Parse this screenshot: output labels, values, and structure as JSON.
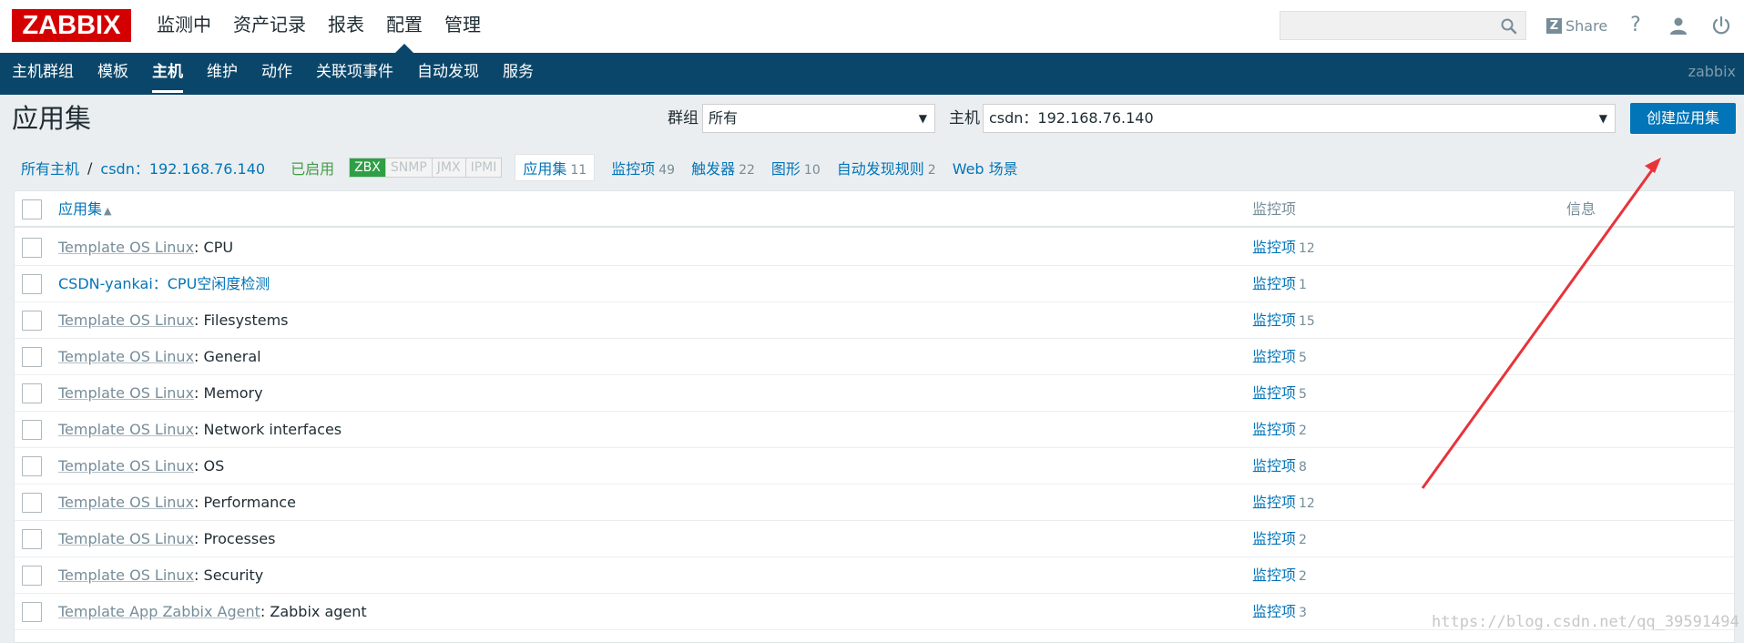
{
  "logo": "ZABBIX",
  "main_menu": [
    {
      "label": "监测中",
      "active": false
    },
    {
      "label": "资产记录",
      "active": false
    },
    {
      "label": "报表",
      "active": false
    },
    {
      "label": "配置",
      "active": true
    },
    {
      "label": "管理",
      "active": false
    }
  ],
  "search": {
    "placeholder": ""
  },
  "share_label": "Share",
  "sub_menu": [
    {
      "label": "主机群组",
      "active": false
    },
    {
      "label": "模板",
      "active": false
    },
    {
      "label": "主机",
      "active": true
    },
    {
      "label": "维护",
      "active": false
    },
    {
      "label": "动作",
      "active": false
    },
    {
      "label": "关联项事件",
      "active": false
    },
    {
      "label": "自动发现",
      "active": false
    },
    {
      "label": "服务",
      "active": false
    }
  ],
  "server_name": "zabbix",
  "page_title": "应用集",
  "filter": {
    "group_label": "群组",
    "group_value": "所有",
    "host_label": "主机",
    "host_value": "csdn：192.168.76.140"
  },
  "create_button": "创建应用集",
  "breadcrumb": {
    "all_hosts": "所有主机",
    "separator": "/",
    "host": "csdn：192.168.76.140",
    "status": "已启用"
  },
  "availability": [
    {
      "label": "ZBX",
      "on": true
    },
    {
      "label": "SNMP",
      "on": false
    },
    {
      "label": "JMX",
      "on": false
    },
    {
      "label": "IPMI",
      "on": false
    }
  ],
  "host_tabs": [
    {
      "label": "应用集",
      "count": "11",
      "current": true
    },
    {
      "label": "监控项",
      "count": "49",
      "current": false
    },
    {
      "label": "触发器",
      "count": "22",
      "current": false
    },
    {
      "label": "图形",
      "count": "10",
      "current": false
    },
    {
      "label": "自动发现规则",
      "count": "2",
      "current": false
    },
    {
      "label": "Web 场景",
      "count": "",
      "current": false
    }
  ],
  "table": {
    "col_application": "应用集",
    "col_items": "监控项",
    "col_info": "信息",
    "rows": [
      {
        "template": "Template OS Linux",
        "sep": ": ",
        "name": "CPU",
        "linked": false,
        "items_label": "监控项",
        "items_count": "12"
      },
      {
        "template": "",
        "sep": "",
        "name": "CSDN-yankai：CPU空闲度检测",
        "linked": true,
        "items_label": "监控项",
        "items_count": "1"
      },
      {
        "template": "Template OS Linux",
        "sep": ": ",
        "name": "Filesystems",
        "linked": false,
        "items_label": "监控项",
        "items_count": "15"
      },
      {
        "template": "Template OS Linux",
        "sep": ": ",
        "name": "General",
        "linked": false,
        "items_label": "监控项",
        "items_count": "5"
      },
      {
        "template": "Template OS Linux",
        "sep": ": ",
        "name": "Memory",
        "linked": false,
        "items_label": "监控项",
        "items_count": "5"
      },
      {
        "template": "Template OS Linux",
        "sep": ": ",
        "name": "Network interfaces",
        "linked": false,
        "items_label": "监控项",
        "items_count": "2"
      },
      {
        "template": "Template OS Linux",
        "sep": ": ",
        "name": "OS",
        "linked": false,
        "items_label": "监控项",
        "items_count": "8"
      },
      {
        "template": "Template OS Linux",
        "sep": ": ",
        "name": "Performance",
        "linked": false,
        "items_label": "监控项",
        "items_count": "12"
      },
      {
        "template": "Template OS Linux",
        "sep": ": ",
        "name": "Processes",
        "linked": false,
        "items_label": "监控项",
        "items_count": "2"
      },
      {
        "template": "Template OS Linux",
        "sep": ": ",
        "name": "Security",
        "linked": false,
        "items_label": "监控项",
        "items_count": "2"
      },
      {
        "template": "Template App Zabbix Agent",
        "sep": ": ",
        "name": "Zabbix agent",
        "linked": false,
        "items_label": "监控项",
        "items_count": "3"
      }
    ]
  },
  "watermark": "https://blog.csdn.net/qq_39591494",
  "colors": {
    "header_bar": "#0a466a",
    "logo": "#d40000",
    "link": "#0275b8",
    "enabled": "#429e47",
    "arrow": "#e8333a"
  }
}
